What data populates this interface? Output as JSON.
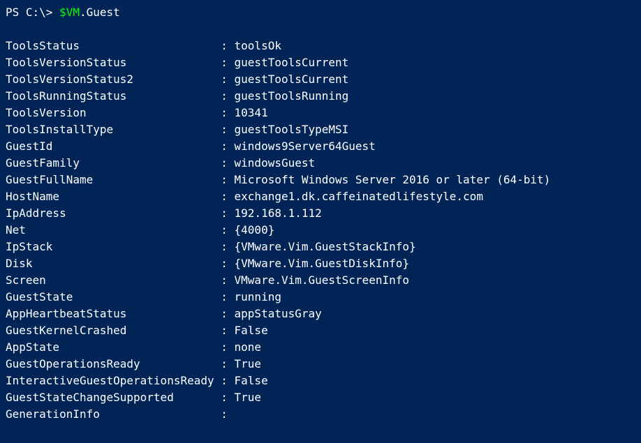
{
  "prompt": {
    "prefix": "PS C:\\> ",
    "variable": "$VM",
    "property": ".Guest"
  },
  "output": {
    "rows": [
      {
        "name": "ToolsStatus",
        "value": "toolsOk"
      },
      {
        "name": "ToolsVersionStatus",
        "value": "guestToolsCurrent"
      },
      {
        "name": "ToolsVersionStatus2",
        "value": "guestToolsCurrent"
      },
      {
        "name": "ToolsRunningStatus",
        "value": "guestToolsRunning"
      },
      {
        "name": "ToolsVersion",
        "value": "10341"
      },
      {
        "name": "ToolsInstallType",
        "value": "guestToolsTypeMSI"
      },
      {
        "name": "GuestId",
        "value": "windows9Server64Guest"
      },
      {
        "name": "GuestFamily",
        "value": "windowsGuest"
      },
      {
        "name": "GuestFullName",
        "value": "Microsoft Windows Server 2016 or later (64-bit)"
      },
      {
        "name": "HostName",
        "value": "exchange1.dk.caffeinatedlifestyle.com"
      },
      {
        "name": "IpAddress",
        "value": "192.168.1.112"
      },
      {
        "name": "Net",
        "value": "{4000}"
      },
      {
        "name": "IpStack",
        "value": "{VMware.Vim.GuestStackInfo}"
      },
      {
        "name": "Disk",
        "value": "{VMware.Vim.GuestDiskInfo}"
      },
      {
        "name": "Screen",
        "value": "VMware.Vim.GuestScreenInfo"
      },
      {
        "name": "GuestState",
        "value": "running"
      },
      {
        "name": "AppHeartbeatStatus",
        "value": "appStatusGray"
      },
      {
        "name": "GuestKernelCrashed",
        "value": "False"
      },
      {
        "name": "AppState",
        "value": "none"
      },
      {
        "name": "GuestOperationsReady",
        "value": "True"
      },
      {
        "name": "InteractiveGuestOperationsReady",
        "value": "False"
      },
      {
        "name": "GuestStateChangeSupported",
        "value": "True"
      },
      {
        "name": "GenerationInfo",
        "value": ""
      }
    ],
    "nameWidth": 31
  }
}
